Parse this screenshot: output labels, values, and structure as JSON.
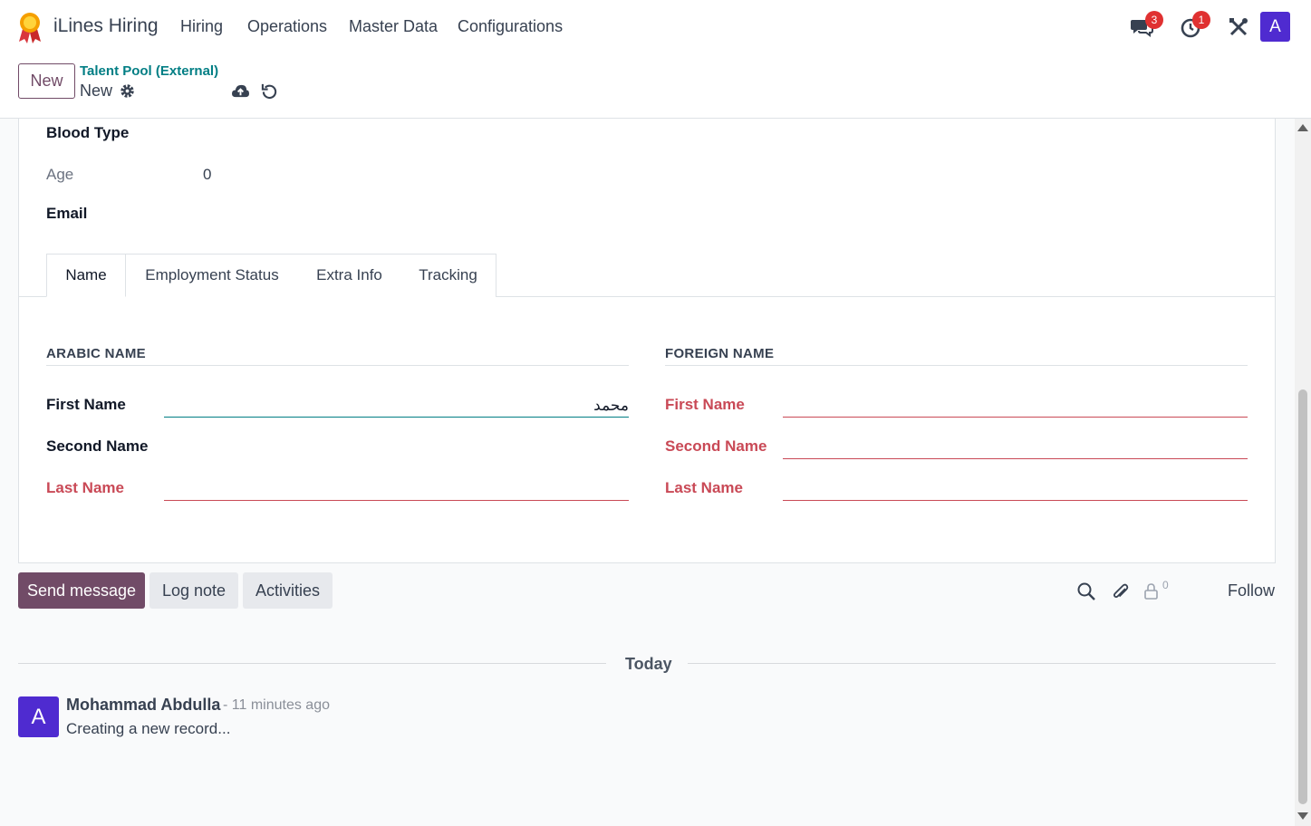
{
  "navbar": {
    "app_title": "iLines Hiring",
    "menu": [
      "Hiring",
      "Operations",
      "Master Data",
      "Configurations"
    ],
    "messages_count": "3",
    "activities_count": "1",
    "user_initial": "A",
    "logo_icon": "ribbon-award-icon",
    "brand_color": "#714b67"
  },
  "control_panel": {
    "new_button": "New",
    "breadcrumb_parent": "Talent Pool (External)",
    "breadcrumb_current": "New"
  },
  "form": {
    "blood_type_label": "Blood Type",
    "age_label": "Age",
    "age_value": "0",
    "email_label": "Email",
    "tabs": [
      "Name",
      "Employment Status",
      "Extra Info",
      "Tracking"
    ],
    "active_tab": "Name",
    "arabic_section": {
      "title": "ARABIC NAME",
      "first_name_label": "First Name",
      "first_name_value": "محمد",
      "second_name_label": "Second Name",
      "last_name_label": "Last Name"
    },
    "foreign_section": {
      "title": "FOREIGN NAME",
      "first_name_label": "First Name",
      "second_name_label": "Second Name",
      "last_name_label": "Last Name"
    }
  },
  "chatter": {
    "send_message": "Send message",
    "log_note": "Log note",
    "activities": "Activities",
    "followers_count": "0",
    "follow": "Follow",
    "date_separator": "Today",
    "message": {
      "author_initial": "A",
      "author": "Mohammad Abdulla",
      "time": "- 11 minutes ago",
      "body": "Creating a new record..."
    }
  }
}
